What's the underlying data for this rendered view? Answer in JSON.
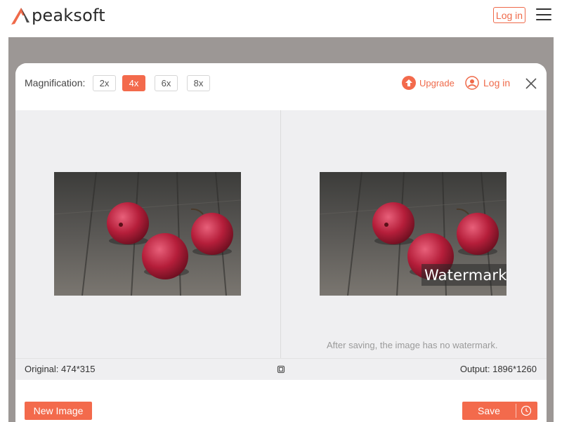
{
  "site": {
    "brand": "peaksoft",
    "login_label": "Log in",
    "accent_color": "#f36a4c"
  },
  "dialog": {
    "magnification_label": "Magnification:",
    "magnification_options": [
      "2x",
      "4x",
      "6x",
      "8x"
    ],
    "selected_magnification": "4x",
    "upgrade_label": "Upgrade",
    "login_label": "Log in",
    "watermark_text": "Watermark",
    "note": "After saving, the image has no watermark.",
    "original_info": "Original: 474*315",
    "output_info": "Output: 1896*1260",
    "new_image_label": "New Image",
    "save_label": "Save"
  },
  "icons": {
    "logo": "peaksoft-logo-icon",
    "menu": "hamburger-menu-icon",
    "upgrade": "upgrade-arrow-icon",
    "user": "user-icon",
    "close": "close-icon",
    "compare": "compare-icon",
    "clock": "clock-icon"
  }
}
